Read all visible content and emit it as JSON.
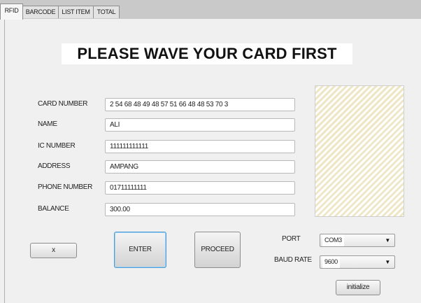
{
  "tabs": [
    {
      "label": "RFID",
      "active": true
    },
    {
      "label": "BARCODE",
      "active": false
    },
    {
      "label": "LIST ITEM",
      "active": false
    },
    {
      "label": "TOTAL",
      "active": false
    }
  ],
  "banner": "PLEASE WAVE YOUR CARD FIRST",
  "form": {
    "card_number": {
      "label": "CARD NUMBER",
      "value": "2 54 68 48 49 48 57 51 66 48 48 53 70 3"
    },
    "name": {
      "label": "NAME",
      "value": "ALI"
    },
    "ic_number": {
      "label": "IC NUMBER",
      "value": "111111111111"
    },
    "address": {
      "label": "ADDRESS",
      "value": "AMPANG"
    },
    "phone_number": {
      "label": "PHONE NUMBER",
      "value": "01711111111"
    },
    "balance": {
      "label": "BALANCE",
      "value": "300.00"
    }
  },
  "buttons": {
    "small": "x",
    "enter": "ENTER",
    "proceed": "PROCEED",
    "initialize": "initialize"
  },
  "serial": {
    "port_label": "PORT",
    "port_value": "COM3",
    "baud_label": "BAUD RATE",
    "baud_value": "9600"
  },
  "colors": {
    "focus_border": "#4a9bd6",
    "photo_stripe": "#efe6c6"
  }
}
